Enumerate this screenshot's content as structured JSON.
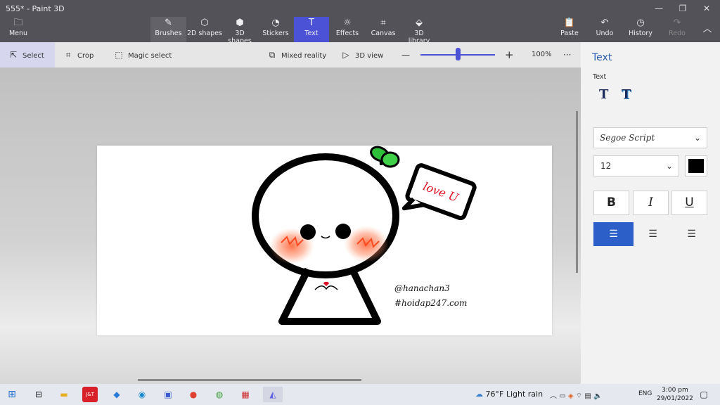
{
  "window": {
    "title": "555* - Paint 3D"
  },
  "ribbon": {
    "menu": "Menu",
    "tools": [
      {
        "key": "brushes",
        "label": "Brushes"
      },
      {
        "key": "2d_shapes",
        "label": "2D shapes"
      },
      {
        "key": "3d_shapes",
        "label": "3D shapes"
      },
      {
        "key": "stickers",
        "label": "Stickers"
      },
      {
        "key": "text",
        "label": "Text"
      },
      {
        "key": "effects",
        "label": "Effects"
      },
      {
        "key": "canvas",
        "label": "Canvas"
      },
      {
        "key": "3d_library",
        "label": "3D library"
      }
    ],
    "paste": "Paste",
    "undo": "Undo",
    "history": "History",
    "redo": "Redo"
  },
  "toolbar": {
    "select": "Select",
    "crop": "Crop",
    "magic_select": "Magic select",
    "mixed_reality": "Mixed reality",
    "view_3d": "3D view",
    "zoom_minus": "—",
    "zoom_plus": "+",
    "zoom_level": "100%",
    "more": "···",
    "zoom_fraction": 0.5
  },
  "canvas": {
    "bubble_text": "love U",
    "handle": "@hanachan3",
    "site": "#hoidap247.com"
  },
  "panel": {
    "title": "Text",
    "subtitle": "Text",
    "font": "Segoe Script",
    "size": "12",
    "color": "#000000",
    "bold": "B",
    "italic": "I",
    "underline": "U"
  },
  "taskbar": {
    "apps": [
      {
        "key": "task-view",
        "label": "⊟"
      },
      {
        "key": "file-explorer",
        "label": "▬"
      },
      {
        "key": "jnt",
        "label": "J&T"
      },
      {
        "key": "app-blue",
        "label": "◆"
      },
      {
        "key": "edge",
        "label": "◉"
      },
      {
        "key": "store",
        "label": "▣"
      },
      {
        "key": "chrome",
        "label": "●"
      },
      {
        "key": "app-green",
        "label": "◍"
      },
      {
        "key": "app-red",
        "label": "▦"
      },
      {
        "key": "paint3d",
        "label": "◭"
      }
    ],
    "weather": "76°F  Light rain",
    "lang": "ENG",
    "time": "3:00 pm",
    "date": "29/01/2022"
  },
  "colors": {
    "accent": "#4c52d6",
    "ribbon": "#535259",
    "panel_accent": "#2c5fc8"
  }
}
